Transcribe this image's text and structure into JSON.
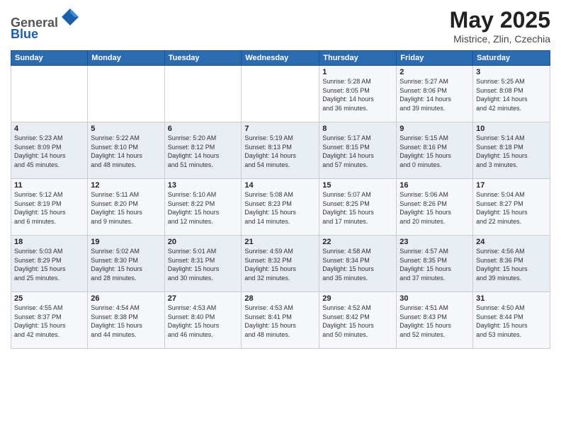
{
  "header": {
    "logo_line1": "General",
    "logo_line2": "Blue",
    "title": "May 2025",
    "subtitle": "Mistrice, Zlin, Czechia"
  },
  "calendar": {
    "days_of_week": [
      "Sunday",
      "Monday",
      "Tuesday",
      "Wednesday",
      "Thursday",
      "Friday",
      "Saturday"
    ],
    "weeks": [
      [
        {
          "day": "",
          "info": ""
        },
        {
          "day": "",
          "info": ""
        },
        {
          "day": "",
          "info": ""
        },
        {
          "day": "",
          "info": ""
        },
        {
          "day": "1",
          "info": "Sunrise: 5:28 AM\nSunset: 8:05 PM\nDaylight: 14 hours\nand 36 minutes."
        },
        {
          "day": "2",
          "info": "Sunrise: 5:27 AM\nSunset: 8:06 PM\nDaylight: 14 hours\nand 39 minutes."
        },
        {
          "day": "3",
          "info": "Sunrise: 5:25 AM\nSunset: 8:08 PM\nDaylight: 14 hours\nand 42 minutes."
        }
      ],
      [
        {
          "day": "4",
          "info": "Sunrise: 5:23 AM\nSunset: 8:09 PM\nDaylight: 14 hours\nand 45 minutes."
        },
        {
          "day": "5",
          "info": "Sunrise: 5:22 AM\nSunset: 8:10 PM\nDaylight: 14 hours\nand 48 minutes."
        },
        {
          "day": "6",
          "info": "Sunrise: 5:20 AM\nSunset: 8:12 PM\nDaylight: 14 hours\nand 51 minutes."
        },
        {
          "day": "7",
          "info": "Sunrise: 5:19 AM\nSunset: 8:13 PM\nDaylight: 14 hours\nand 54 minutes."
        },
        {
          "day": "8",
          "info": "Sunrise: 5:17 AM\nSunset: 8:15 PM\nDaylight: 14 hours\nand 57 minutes."
        },
        {
          "day": "9",
          "info": "Sunrise: 5:15 AM\nSunset: 8:16 PM\nDaylight: 15 hours\nand 0 minutes."
        },
        {
          "day": "10",
          "info": "Sunrise: 5:14 AM\nSunset: 8:18 PM\nDaylight: 15 hours\nand 3 minutes."
        }
      ],
      [
        {
          "day": "11",
          "info": "Sunrise: 5:12 AM\nSunset: 8:19 PM\nDaylight: 15 hours\nand 6 minutes."
        },
        {
          "day": "12",
          "info": "Sunrise: 5:11 AM\nSunset: 8:20 PM\nDaylight: 15 hours\nand 9 minutes."
        },
        {
          "day": "13",
          "info": "Sunrise: 5:10 AM\nSunset: 8:22 PM\nDaylight: 15 hours\nand 12 minutes."
        },
        {
          "day": "14",
          "info": "Sunrise: 5:08 AM\nSunset: 8:23 PM\nDaylight: 15 hours\nand 14 minutes."
        },
        {
          "day": "15",
          "info": "Sunrise: 5:07 AM\nSunset: 8:25 PM\nDaylight: 15 hours\nand 17 minutes."
        },
        {
          "day": "16",
          "info": "Sunrise: 5:06 AM\nSunset: 8:26 PM\nDaylight: 15 hours\nand 20 minutes."
        },
        {
          "day": "17",
          "info": "Sunrise: 5:04 AM\nSunset: 8:27 PM\nDaylight: 15 hours\nand 22 minutes."
        }
      ],
      [
        {
          "day": "18",
          "info": "Sunrise: 5:03 AM\nSunset: 8:29 PM\nDaylight: 15 hours\nand 25 minutes."
        },
        {
          "day": "19",
          "info": "Sunrise: 5:02 AM\nSunset: 8:30 PM\nDaylight: 15 hours\nand 28 minutes."
        },
        {
          "day": "20",
          "info": "Sunrise: 5:01 AM\nSunset: 8:31 PM\nDaylight: 15 hours\nand 30 minutes."
        },
        {
          "day": "21",
          "info": "Sunrise: 4:59 AM\nSunset: 8:32 PM\nDaylight: 15 hours\nand 32 minutes."
        },
        {
          "day": "22",
          "info": "Sunrise: 4:58 AM\nSunset: 8:34 PM\nDaylight: 15 hours\nand 35 minutes."
        },
        {
          "day": "23",
          "info": "Sunrise: 4:57 AM\nSunset: 8:35 PM\nDaylight: 15 hours\nand 37 minutes."
        },
        {
          "day": "24",
          "info": "Sunrise: 4:56 AM\nSunset: 8:36 PM\nDaylight: 15 hours\nand 39 minutes."
        }
      ],
      [
        {
          "day": "25",
          "info": "Sunrise: 4:55 AM\nSunset: 8:37 PM\nDaylight: 15 hours\nand 42 minutes."
        },
        {
          "day": "26",
          "info": "Sunrise: 4:54 AM\nSunset: 8:38 PM\nDaylight: 15 hours\nand 44 minutes."
        },
        {
          "day": "27",
          "info": "Sunrise: 4:53 AM\nSunset: 8:40 PM\nDaylight: 15 hours\nand 46 minutes."
        },
        {
          "day": "28",
          "info": "Sunrise: 4:53 AM\nSunset: 8:41 PM\nDaylight: 15 hours\nand 48 minutes."
        },
        {
          "day": "29",
          "info": "Sunrise: 4:52 AM\nSunset: 8:42 PM\nDaylight: 15 hours\nand 50 minutes."
        },
        {
          "day": "30",
          "info": "Sunrise: 4:51 AM\nSunset: 8:43 PM\nDaylight: 15 hours\nand 52 minutes."
        },
        {
          "day": "31",
          "info": "Sunrise: 4:50 AM\nSunset: 8:44 PM\nDaylight: 15 hours\nand 53 minutes."
        }
      ]
    ]
  }
}
